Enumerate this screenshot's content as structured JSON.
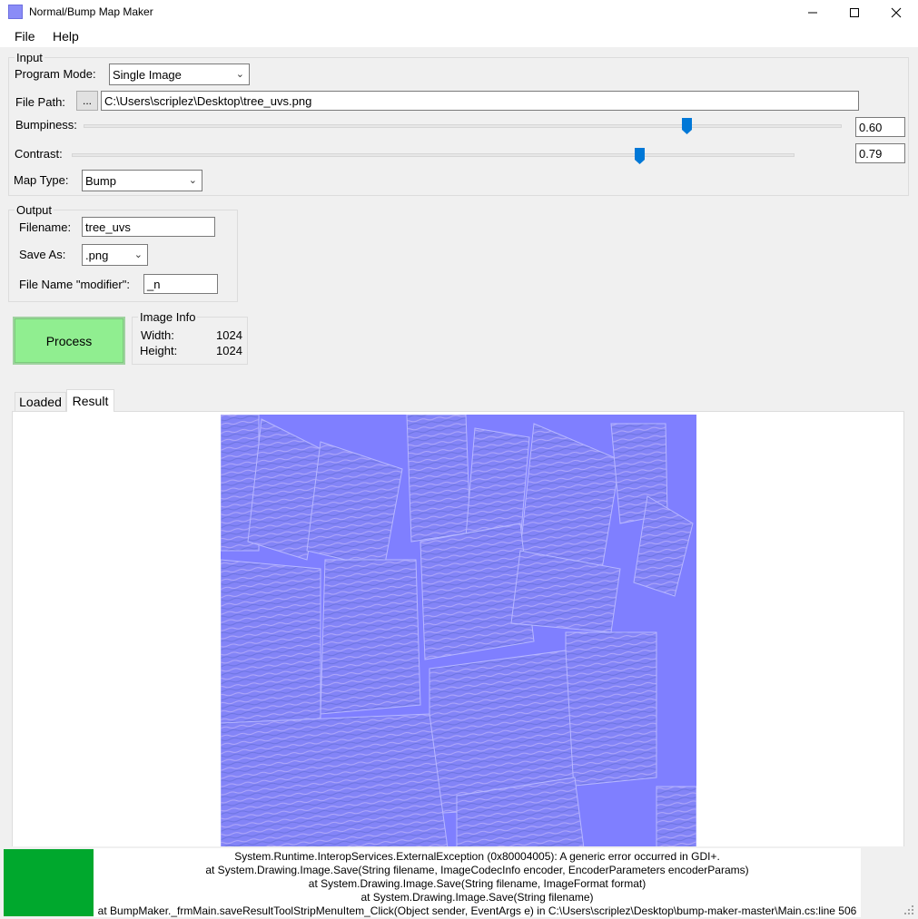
{
  "window": {
    "title": "Normal/Bump Map Maker",
    "minimize_icon": "minimize-icon",
    "maximize_icon": "maximize-icon",
    "close_icon": "close-icon"
  },
  "menu": {
    "items": [
      "File",
      "Help"
    ]
  },
  "input": {
    "legend": "Input",
    "program_mode_label": "Program Mode:",
    "program_mode_value": "Single Image",
    "file_path_label": "File Path:",
    "browse_label": "...",
    "file_path_value": "C:\\Users\\scriplez\\Desktop\\tree_uvs.png",
    "bumpiness_label": "Bumpiness:",
    "bumpiness_value": "0.60",
    "contrast_label": "Contrast:",
    "contrast_value": "0.79",
    "map_type_label": "Map Type:",
    "map_type_value": "Bump"
  },
  "output": {
    "legend": "Output",
    "filename_label": "Filename:",
    "filename_value": "tree_uvs",
    "save_as_label": "Save As:",
    "save_as_value": ".png",
    "modifier_label": "File Name \"modifier\":",
    "modifier_value": "_n"
  },
  "process_label": "Process",
  "image_info": {
    "legend": "Image Info",
    "width_label": "Width:",
    "width_value": "1024",
    "height_label": "Height:",
    "height_value": "1024"
  },
  "tabs": {
    "loaded": "Loaded",
    "result": "Result",
    "active": "Result"
  },
  "status": {
    "indicator_color": "#00a82d",
    "lines": [
      "System.Runtime.InteropServices.ExternalException (0x80004005): A generic error occurred in GDI+.",
      "at System.Drawing.Image.Save(String filename, ImageCodecInfo encoder, EncoderParameters encoderParams)",
      "at System.Drawing.Image.Save(String filename, ImageFormat format)",
      "at System.Drawing.Image.Save(String filename)",
      "at BumpMaker._frmMain.saveResultToolStripMenuItem_Click(Object sender, EventArgs e) in C:\\Users\\scriplez\\Desktop\\bump-maker-master\\Main.cs:line 506"
    ]
  },
  "colors": {
    "normal_map_base": "#7f7fff",
    "process_button": "#90ee90",
    "slider_thumb": "#0078d7"
  }
}
